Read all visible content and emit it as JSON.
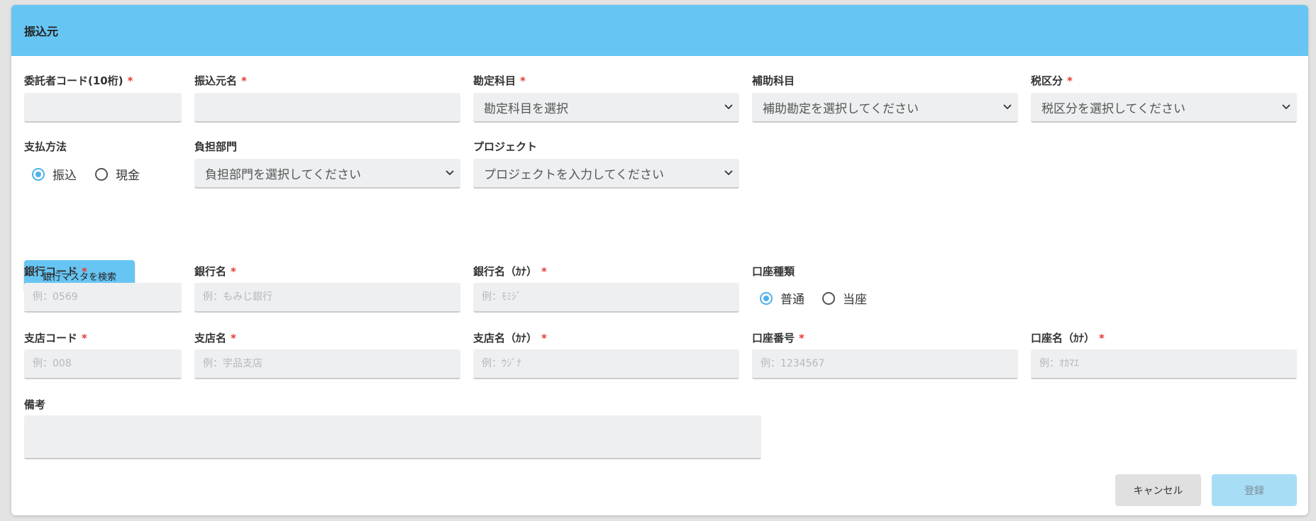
{
  "panel": {
    "title": "振込元"
  },
  "fields": {
    "consignor_code": {
      "label": "委託者コード(10桁)",
      "value": ""
    },
    "payer_name": {
      "label": "振込元名",
      "value": ""
    },
    "account_item": {
      "label": "勘定科目",
      "selected": "勘定科目を選択"
    },
    "sub_account": {
      "label": "補助科目",
      "selected": "補助勘定を選択してください"
    },
    "tax_category": {
      "label": "税区分",
      "selected": "税区分を選択してください"
    },
    "payment_method": {
      "label": "支払方法",
      "options": [
        "振込",
        "現金"
      ],
      "selected": "振込"
    },
    "department": {
      "label": "負担部門",
      "selected": "負担部門を選択してください"
    },
    "project": {
      "label": "プロジェクト",
      "selected": "プロジェクトを入力してください"
    },
    "bank_code": {
      "label": "銀行コード",
      "placeholder": "例：0569"
    },
    "bank_name": {
      "label": "銀行名",
      "placeholder": "例：もみじ銀行"
    },
    "bank_name_kana": {
      "label": "銀行名（ｶﾅ）",
      "placeholder": "例：ﾓﾐｼﾞ"
    },
    "account_type": {
      "label": "口座種類",
      "options": [
        "普通",
        "当座"
      ],
      "selected": "普通"
    },
    "branch_code": {
      "label": "支店コード",
      "placeholder": "例：008"
    },
    "branch_name": {
      "label": "支店名",
      "placeholder": "例：宇品支店"
    },
    "branch_name_kana": {
      "label": "支店名（ｶﾅ）",
      "placeholder": "例：ｳｼﾞﾅ"
    },
    "account_number": {
      "label": "口座番号",
      "placeholder": "例：1234567"
    },
    "account_name_kana": {
      "label": "口座名（ｶﾅ）",
      "placeholder": "例：ｵｶﾏｴ"
    },
    "remarks": {
      "label": "備考",
      "value": ""
    }
  },
  "required_mark": "*",
  "buttons": {
    "search_bank": "銀行マスタを検索",
    "cancel": "キャンセル",
    "submit": "登録"
  },
  "colors": {
    "header": "#67c5f3",
    "required": "#e53935",
    "radio_active": "#4fb0ea",
    "submit_disabled": "#a8ddf6"
  }
}
